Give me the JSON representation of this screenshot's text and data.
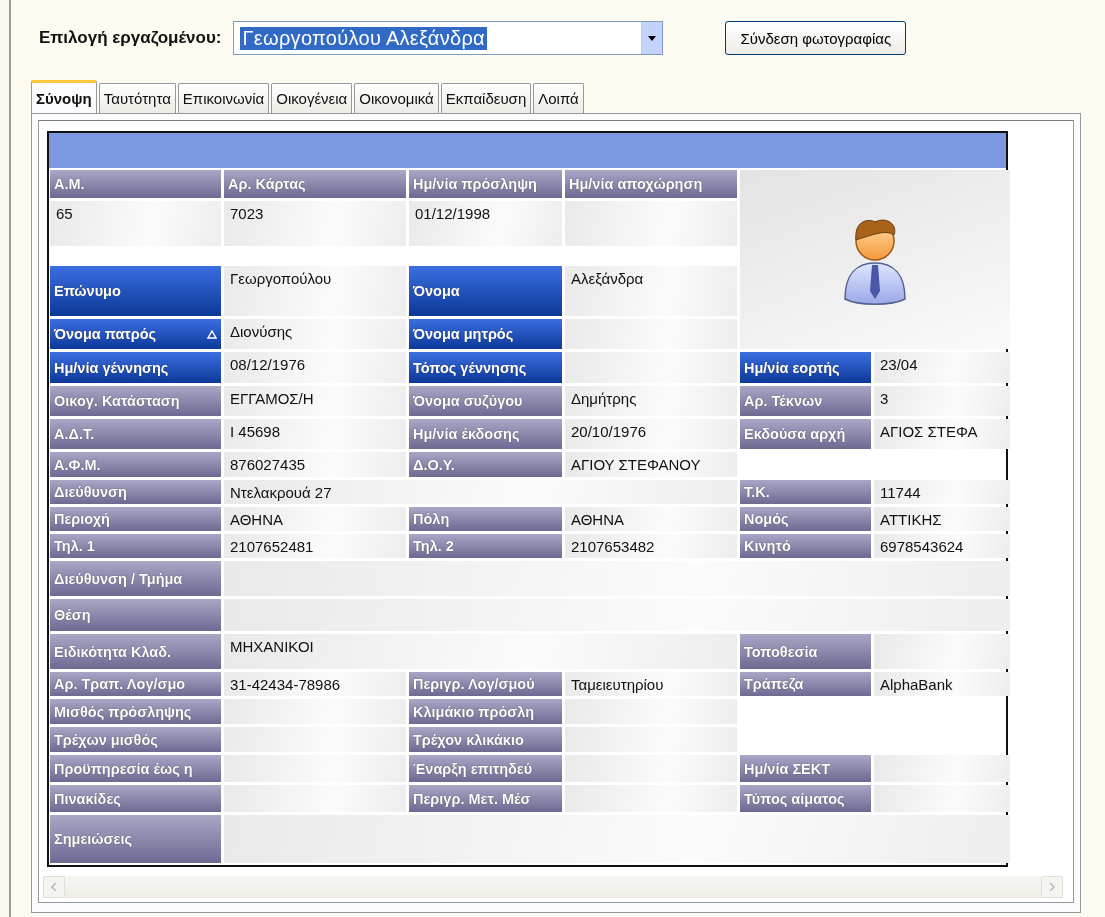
{
  "employee_select": {
    "label": "Επιλογή εργαζομένου:",
    "value": "Γεωργοπούλου Αλεξάνδρα",
    "highlighted": true
  },
  "photo_button": "Σύνδεση φωτογραφίας",
  "tabs": [
    {
      "label": "Σύνοψη",
      "selected": true
    },
    {
      "label": "Ταυτότητα",
      "selected": false
    },
    {
      "label": "Επικοινωνία",
      "selected": false
    },
    {
      "label": "Οικογένεια",
      "selected": false
    },
    {
      "label": "Οικονομικά",
      "selected": false
    },
    {
      "label": "Εκπαίδευση",
      "selected": false
    },
    {
      "label": "Λοιπά",
      "selected": false
    }
  ],
  "summary": {
    "top_fields": [
      {
        "label": "Α.Μ.",
        "value": "65"
      },
      {
        "label": "Αρ. Κάρτας",
        "value": "7023"
      },
      {
        "label": "Ημ/νία πρόσληψη",
        "value": "01/12/1998"
      },
      {
        "label": "Ημ/νία αποχώρηση"
      }
    ],
    "rows": [
      {
        "fields": [
          {
            "label": "Επώνυμο",
            "kind": "key",
            "value": "Γεωργοπούλου"
          },
          {
            "label": "Όνομα",
            "kind": "key",
            "value": "Αλεξάνδρα"
          }
        ]
      },
      {
        "fields": [
          {
            "label": "Όνομα πατρός",
            "kind": "key",
            "value": "Διονύσης",
            "sorted": true
          },
          {
            "label": "Όνομα μητρός",
            "kind": "key"
          }
        ]
      },
      {
        "fields": [
          {
            "label": "Ημ/νία γέννησης",
            "kind": "key",
            "value": "08/12/1976"
          },
          {
            "label": "Τόπος γέννησης",
            "kind": "key"
          },
          {
            "label": "Ημ/νία εορτής",
            "kind": "key",
            "value": "23/04"
          }
        ]
      },
      {
        "fields": [
          {
            "label": "Οικογ. Κατάσταση",
            "kind": "plain",
            "value": "ΕΓΓΑΜΟΣ/Η"
          },
          {
            "label": "Όνομα συζύγου",
            "kind": "plain",
            "value": "Δημήτρης"
          },
          {
            "label": "Αρ. Τέκνων",
            "kind": "plain",
            "value": "3"
          }
        ]
      },
      {
        "fields": [
          {
            "label": "Α.Δ.Τ.",
            "kind": "plain",
            "value": "Ι 45698"
          },
          {
            "label": "Ημ/νία έκδοσης",
            "kind": "plain",
            "value": "20/10/1976"
          },
          {
            "label": "Εκδούσα αρχή",
            "kind": "plain",
            "value": "ΑΓΙΟΣ ΣΤΕΦΑ"
          }
        ]
      },
      {
        "fields": [
          {
            "label": "Α.Φ.Μ.",
            "kind": "plain",
            "value": "876027435"
          },
          {
            "label": "Δ.Ο.Υ.",
            "kind": "plain",
            "value": "ΑΓΙΟΥ ΣΤΕΦΑΝΟΥ"
          }
        ]
      },
      {
        "fields": [
          {
            "label": "Διεύθυνση",
            "kind": "plain",
            "value": "Ντελακρουά 27"
          },
          {
            "label": "Τ.Κ.",
            "kind": "plain",
            "value": "11744"
          }
        ]
      },
      {
        "fields": [
          {
            "label": "Περιοχή",
            "kind": "plain",
            "value": "ΑΘΗΝΑ"
          },
          {
            "label": "Πόλη",
            "kind": "plain",
            "value": "ΑΘΗΝΑ"
          },
          {
            "label": "Νομός",
            "kind": "plain",
            "value": "ΑΤΤΙΚΗΣ"
          }
        ]
      },
      {
        "fields": [
          {
            "label": "Τηλ. 1",
            "kind": "plain",
            "value": "2107652481"
          },
          {
            "label": "Τηλ. 2",
            "kind": "plain",
            "value": "2107653482"
          },
          {
            "label": "Κινητό",
            "kind": "plain",
            "value": "6978543624"
          }
        ]
      },
      {
        "fields": [
          {
            "label": "Διεύθυνση / Τμήμα",
            "kind": "plain"
          }
        ]
      },
      {
        "fields": [
          {
            "label": "Θέση",
            "kind": "plain"
          }
        ]
      },
      {
        "fields": [
          {
            "label": "Ειδικότητα Κλαδ.",
            "kind": "plain",
            "value": "ΜΗΧΑΝΙΚΟΙ"
          },
          {
            "label": "Τοποθεσία",
            "kind": "plain"
          }
        ]
      },
      {
        "fields": [
          {
            "label": "Αρ. Τραπ. Λογ/σμο",
            "kind": "plain",
            "value": "31-42434-78986"
          },
          {
            "label": "Περιγρ. Λογ/σμού",
            "kind": "plain",
            "value": "Ταμειευτηρίου"
          },
          {
            "label": "Τράπεζα",
            "kind": "plain",
            "value": "AlphaBank"
          }
        ]
      },
      {
        "fields": [
          {
            "label": "Μισθός πρόσληψης",
            "kind": "plain"
          },
          {
            "label": "Κλιμάκιο πρόσλη",
            "kind": "plain"
          }
        ]
      },
      {
        "fields": [
          {
            "label": "Τρέχων μισθός",
            "kind": "plain"
          },
          {
            "label": "Τρέχον κλικάκιο",
            "kind": "plain"
          }
        ]
      },
      {
        "fields": [
          {
            "label": "Προϋπηρεσία έως η",
            "kind": "plain"
          },
          {
            "label": "Έναρξη επιτηδεύ",
            "kind": "plain"
          },
          {
            "label": "Ημ/νία ΣΕΚΤ",
            "kind": "plain"
          }
        ]
      },
      {
        "fields": [
          {
            "label": "Πινακίδες",
            "kind": "plain"
          },
          {
            "label": "Περιγρ. Μετ. Μέσ",
            "kind": "plain"
          },
          {
            "label": "Τύπος αίματος",
            "kind": "plain"
          }
        ]
      },
      {
        "fields": [
          {
            "label": "Σημειώσεις",
            "kind": "plain"
          }
        ]
      }
    ]
  }
}
